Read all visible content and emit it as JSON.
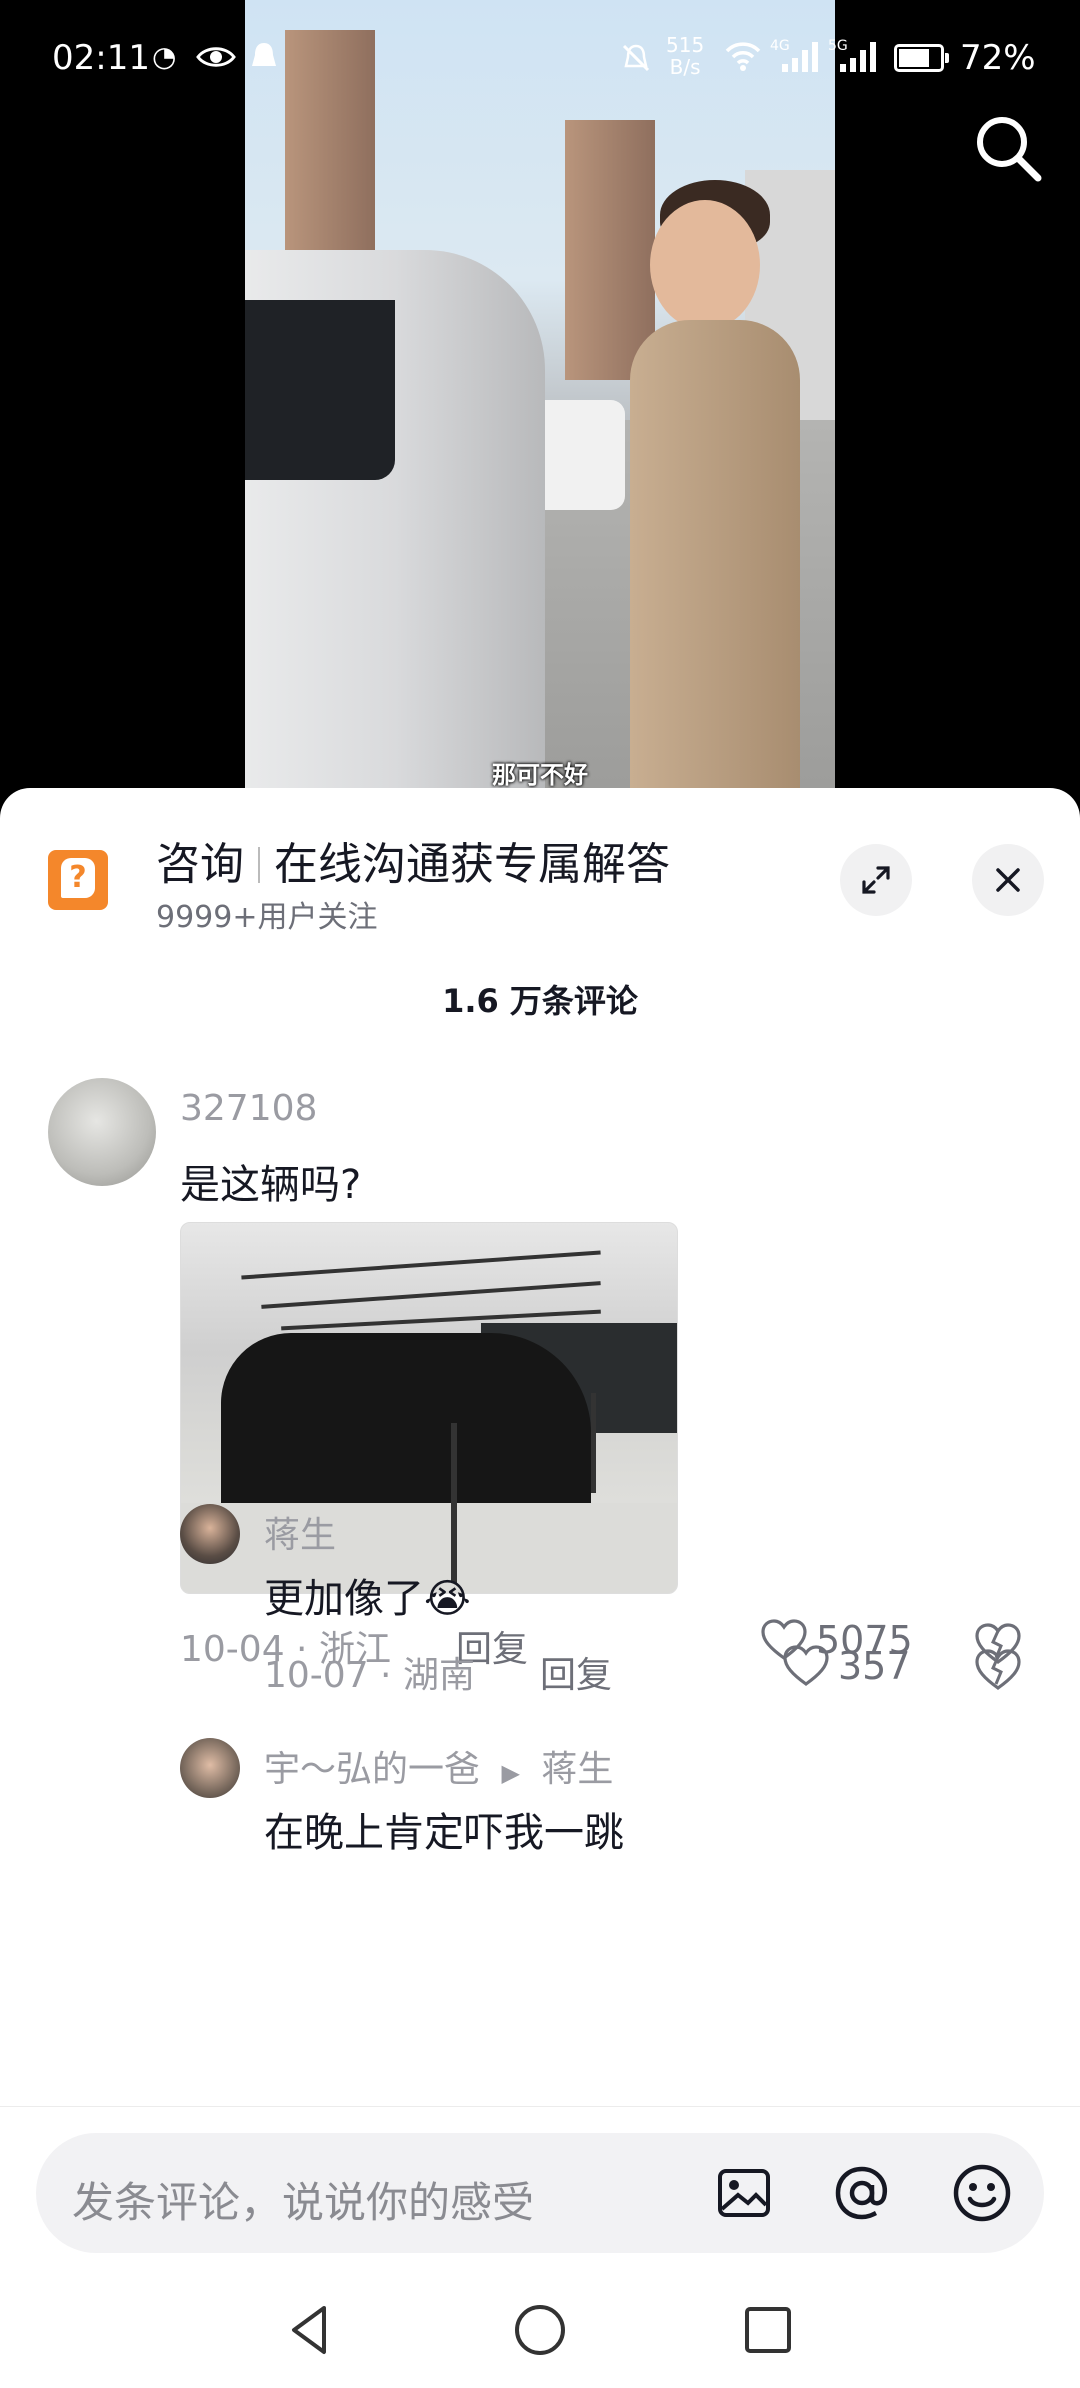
{
  "status_bar": {
    "time": "02:11",
    "net_speed_value": "515",
    "net_speed_unit": "B/s",
    "battery": "72%",
    "network_4g": "4G",
    "network_5g": "5G"
  },
  "video": {
    "subtitle": "那可不好"
  },
  "consult": {
    "title": "咨询",
    "title_desc": "在线沟通获专属解答",
    "subtitle": "9999+用户关注"
  },
  "comments_header": {
    "count": "1.6 万条评论"
  },
  "comments": [
    {
      "user": "327108",
      "text": "是这辆吗?",
      "date_location": "10-04 · 浙江",
      "reply": "回复",
      "likes": "5075"
    },
    {
      "user": "蒋生",
      "text": "更加像了",
      "emoji": "😭",
      "date_location": "10-07 · 湖南",
      "reply": "回复",
      "likes": "357"
    },
    {
      "user": "宇～弘的一爸",
      "reply_to": "蒋生",
      "text": "在晚上肯定吓我一跳"
    }
  ],
  "input_bar": {
    "placeholder": "发条评论，说说你的感受"
  },
  "icons": {
    "search": "search-icon",
    "expand": "expand-icon",
    "close": "close-icon",
    "image": "image-icon",
    "at": "at-icon",
    "emoji": "emoji-icon"
  },
  "colors": {
    "consult_orange": "#f4872b",
    "text_primary": "#161823",
    "text_secondary": "#9a9ba2"
  }
}
